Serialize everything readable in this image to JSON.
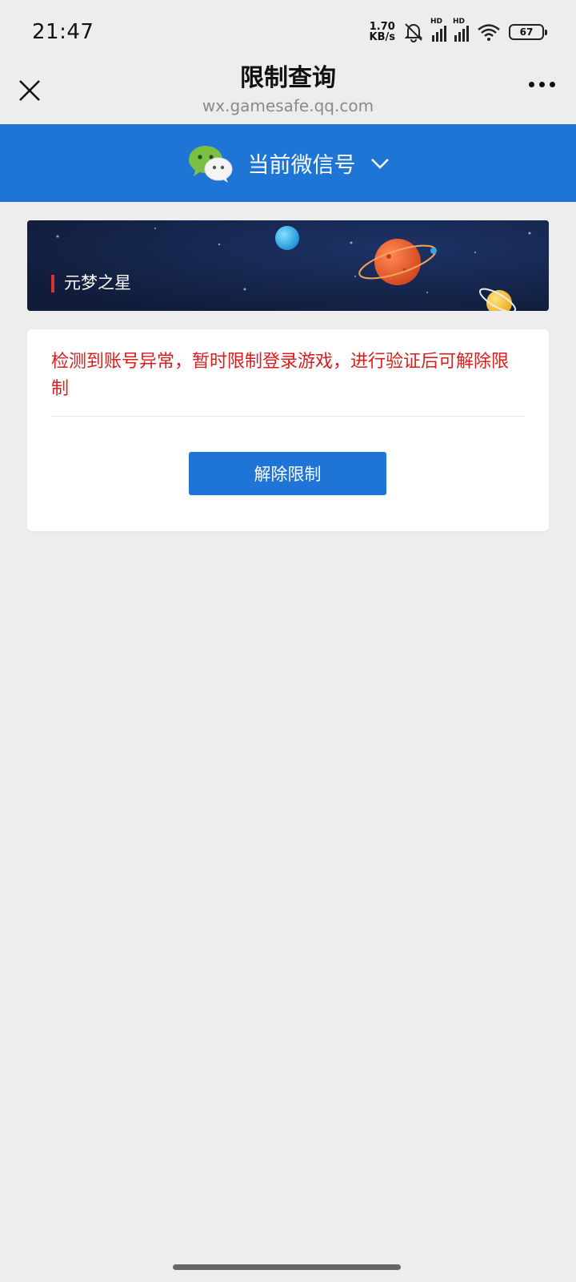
{
  "status_bar": {
    "time": "21:47",
    "net_speed_value": "1.70",
    "net_speed_unit": "KB/s",
    "signal_label_1": "HD",
    "signal_label_2": "HD",
    "battery": "67",
    "icons": [
      "bell-muted-icon",
      "signal-icon",
      "signal-icon",
      "wifi-icon",
      "battery-icon"
    ]
  },
  "title_bar": {
    "title": "限制查询",
    "url": "wx.gamesafe.qq.com",
    "close_icon": "close-icon",
    "more_icon": "more-icon"
  },
  "account": {
    "label": "当前微信号",
    "icon": "wechat-icon",
    "dropdown_icon": "chevron-down-icon",
    "color": "#1f75d6"
  },
  "banner": {
    "game_name": "元梦之星",
    "accent": "#e0322c"
  },
  "card": {
    "message": "检测到账号异常，暂时限制登录游戏，进行验证后可解除限制",
    "message_color": "#d81e1e",
    "button_label": "解除限制",
    "button_color": "#1f75d6"
  }
}
